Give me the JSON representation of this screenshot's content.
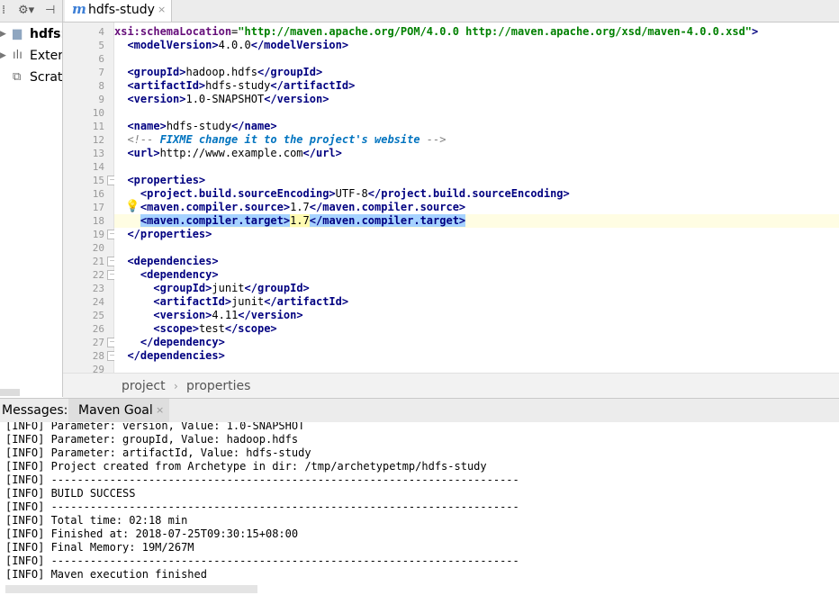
{
  "project_panel": {
    "items": [
      {
        "label": "hdfs:",
        "icon": "folder-icon"
      },
      {
        "label": "Exter",
        "icon": "library-icon"
      },
      {
        "label": "Scrat",
        "icon": "scratch-icon"
      }
    ]
  },
  "tab": {
    "icon_letter": "m",
    "title": "hdfs-study",
    "close": "×"
  },
  "editor": {
    "lines": [
      {
        "n": "4",
        "fold": false,
        "segs": [
          [
            "at",
            "xsi:schemaLocation"
          ],
          [
            "tx",
            "="
          ],
          [
            "av",
            "\"http://maven.apache.org/POM/4.0.0 http://maven.apache.org/xsd/maven-4.0.0.xsd\""
          ],
          [
            "tg",
            ">"
          ]
        ]
      },
      {
        "n": "5",
        "fold": false,
        "segs": [
          [
            "tx",
            "  "
          ],
          [
            "tg",
            "<modelVersion>"
          ],
          [
            "tx",
            "4.0.0"
          ],
          [
            "tg",
            "</modelVersion>"
          ]
        ]
      },
      {
        "n": "6",
        "fold": false,
        "segs": []
      },
      {
        "n": "7",
        "fold": false,
        "segs": [
          [
            "tx",
            "  "
          ],
          [
            "tg",
            "<groupId>"
          ],
          [
            "tx",
            "hadoop.hdfs"
          ],
          [
            "tg",
            "</groupId>"
          ]
        ]
      },
      {
        "n": "8",
        "fold": false,
        "segs": [
          [
            "tx",
            "  "
          ],
          [
            "tg",
            "<artifactId>"
          ],
          [
            "tx",
            "hdfs-study"
          ],
          [
            "tg",
            "</artifactId>"
          ]
        ]
      },
      {
        "n": "9",
        "fold": false,
        "segs": [
          [
            "tx",
            "  "
          ],
          [
            "tg",
            "<version>"
          ],
          [
            "tx",
            "1.0-SNAPSHOT"
          ],
          [
            "tg",
            "</version>"
          ]
        ]
      },
      {
        "n": "10",
        "fold": false,
        "segs": []
      },
      {
        "n": "11",
        "fold": false,
        "segs": [
          [
            "tx",
            "  "
          ],
          [
            "tg",
            "<name>"
          ],
          [
            "tx",
            "hdfs-study"
          ],
          [
            "tg",
            "</name>"
          ]
        ]
      },
      {
        "n": "12",
        "fold": false,
        "segs": [
          [
            "tx",
            "  "
          ],
          [
            "cm",
            "<!-- "
          ],
          [
            "td",
            "FIXME change it to the project's website"
          ],
          [
            "cm",
            " -->"
          ]
        ]
      },
      {
        "n": "13",
        "fold": false,
        "segs": [
          [
            "tx",
            "  "
          ],
          [
            "tg",
            "<url>"
          ],
          [
            "tx",
            "http://www.example.com"
          ],
          [
            "tg",
            "</url>"
          ]
        ]
      },
      {
        "n": "14",
        "fold": false,
        "segs": []
      },
      {
        "n": "15",
        "fold": true,
        "segs": [
          [
            "tx",
            "  "
          ],
          [
            "tg",
            "<properties>"
          ]
        ]
      },
      {
        "n": "16",
        "fold": false,
        "segs": [
          [
            "tx",
            "    "
          ],
          [
            "tg",
            "<project.build.sourceEncoding>"
          ],
          [
            "tx",
            "UTF-8"
          ],
          [
            "tg",
            "</project.build.sourceEncoding>"
          ]
        ]
      },
      {
        "n": "17",
        "fold": false,
        "segs": [
          [
            "tx",
            "    "
          ],
          [
            "tg",
            "<maven.compiler.source>"
          ],
          [
            "tx",
            "1.7"
          ],
          [
            "tg",
            "</maven.compiler.source>"
          ]
        ]
      },
      {
        "n": "18",
        "fold": false,
        "cur": true,
        "segs": [
          [
            "tx",
            "    "
          ],
          [
            "tg hl",
            "<maven.compiler.target>"
          ],
          [
            "tx hly",
            "1.7"
          ],
          [
            "tg hl",
            "</maven.compiler.target>"
          ]
        ]
      },
      {
        "n": "19",
        "fold": true,
        "segs": [
          [
            "tx",
            "  "
          ],
          [
            "tg",
            "</properties>"
          ]
        ]
      },
      {
        "n": "20",
        "fold": false,
        "segs": []
      },
      {
        "n": "21",
        "fold": true,
        "segs": [
          [
            "tx",
            "  "
          ],
          [
            "tg",
            "<dependencies>"
          ]
        ]
      },
      {
        "n": "22",
        "fold": true,
        "segs": [
          [
            "tx",
            "    "
          ],
          [
            "tg",
            "<dependency>"
          ]
        ]
      },
      {
        "n": "23",
        "fold": false,
        "segs": [
          [
            "tx",
            "      "
          ],
          [
            "tg",
            "<groupId>"
          ],
          [
            "tx",
            "junit"
          ],
          [
            "tg",
            "</groupId>"
          ]
        ]
      },
      {
        "n": "24",
        "fold": false,
        "segs": [
          [
            "tx",
            "      "
          ],
          [
            "tg",
            "<artifactId>"
          ],
          [
            "tx",
            "junit"
          ],
          [
            "tg",
            "</artifactId>"
          ]
        ]
      },
      {
        "n": "25",
        "fold": false,
        "segs": [
          [
            "tx",
            "      "
          ],
          [
            "tg",
            "<version>"
          ],
          [
            "tx",
            "4.11"
          ],
          [
            "tg",
            "</version>"
          ]
        ]
      },
      {
        "n": "26",
        "fold": false,
        "segs": [
          [
            "tx",
            "      "
          ],
          [
            "tg",
            "<scope>"
          ],
          [
            "tx",
            "test"
          ],
          [
            "tg",
            "</scope>"
          ]
        ]
      },
      {
        "n": "27",
        "fold": true,
        "segs": [
          [
            "tx",
            "    "
          ],
          [
            "tg",
            "</dependency>"
          ]
        ]
      },
      {
        "n": "28",
        "fold": true,
        "segs": [
          [
            "tx",
            "  "
          ],
          [
            "tg",
            "</dependencies>"
          ]
        ]
      },
      {
        "n": "29",
        "fold": false,
        "segs": []
      }
    ]
  },
  "breadcrumb": {
    "items": [
      "project",
      "properties"
    ],
    "separator": "›"
  },
  "messages": {
    "label": "Messages:",
    "tab": "Maven Goal",
    "close": "×",
    "lines": [
      "[INFO] Parameter: version, Value: 1.0-SNAPSHOT",
      "[INFO] Parameter: groupId, Value: hadoop.hdfs",
      "[INFO] Parameter: artifactId, Value: hdfs-study",
      "[INFO] Project created from Archetype in dir: /tmp/archetypetmp/hdfs-study",
      "[INFO] ------------------------------------------------------------------------",
      "[INFO] BUILD SUCCESS",
      "[INFO] ------------------------------------------------------------------------",
      "[INFO] Total time: 02:18 min",
      "[INFO] Finished at: 2018-07-25T09:30:15+08:00",
      "[INFO] Final Memory: 19M/267M",
      "[INFO] ------------------------------------------------------------------------",
      "[INFO] Maven execution finished"
    ]
  }
}
